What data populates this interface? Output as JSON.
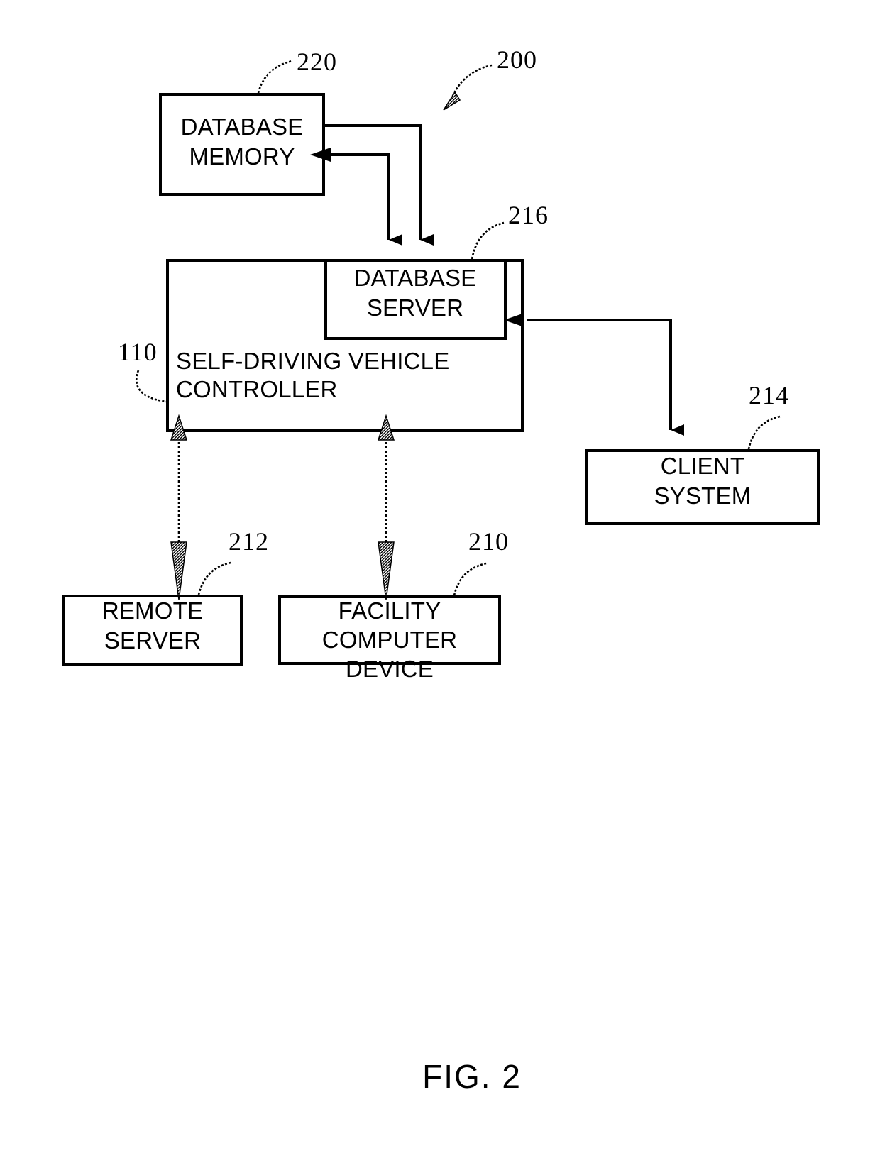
{
  "figure": {
    "caption": "FIG. 2",
    "system_ref": "200"
  },
  "boxes": {
    "database_memory": {
      "ref": "220",
      "line1": "DATABASE",
      "line2": "MEMORY"
    },
    "database_server": {
      "ref": "216",
      "line1": "DATABASE",
      "line2": "SERVER"
    },
    "self_driving_vehicle_controller": {
      "ref": "110",
      "line1": "SELF-DRIVING VEHICLE",
      "line2": "CONTROLLER"
    },
    "client_system": {
      "ref": "214",
      "line1": "CLIENT",
      "line2": "SYSTEM"
    },
    "remote_server": {
      "ref": "212",
      "line1": "REMOTE",
      "line2": "SERVER"
    },
    "facility_computer_device": {
      "ref": "210",
      "line1": "FACILITY",
      "line2": "COMPUTER",
      "line3": "DEVICE"
    }
  },
  "connectors": [
    {
      "name": "memory-to-server",
      "from": "database_memory",
      "to": "database_server",
      "style": "solid",
      "arrowheads": "end"
    },
    {
      "name": "server-to-memory",
      "from": "database_server",
      "to": "database_memory",
      "style": "solid",
      "arrowheads": "end"
    },
    {
      "name": "controller-to-client-system",
      "from": "self_driving_vehicle_controller",
      "to": "client_system",
      "style": "solid",
      "arrowheads": "both"
    },
    {
      "name": "controller-to-remote-server",
      "from": "self_driving_vehicle_controller",
      "to": "remote_server",
      "style": "dashed",
      "arrowheads": "both"
    },
    {
      "name": "controller-to-facility-computer-device",
      "from": "self_driving_vehicle_controller",
      "to": "facility_computer_device",
      "style": "dashed",
      "arrowheads": "both"
    }
  ],
  "colors": {
    "background": "#ffffff",
    "ink": "#000000"
  }
}
